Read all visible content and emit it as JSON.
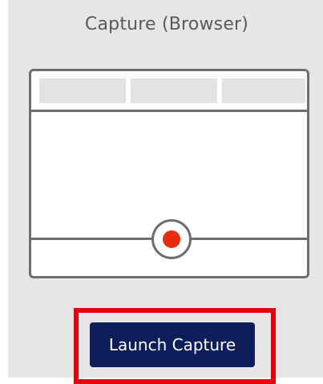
{
  "panel": {
    "title": "Capture (Browser)"
  },
  "illustration": {
    "tabs": [
      "",
      "",
      ""
    ],
    "record_icon": "record-icon"
  },
  "actions": {
    "launch_label": "Launch Capture"
  },
  "colors": {
    "panel_bg": "#e6e6e6",
    "outline": "#6e6e6e",
    "record_red": "#e82d0c",
    "button_navy": "#0e1e5b",
    "highlight_red": "#e4000f"
  }
}
